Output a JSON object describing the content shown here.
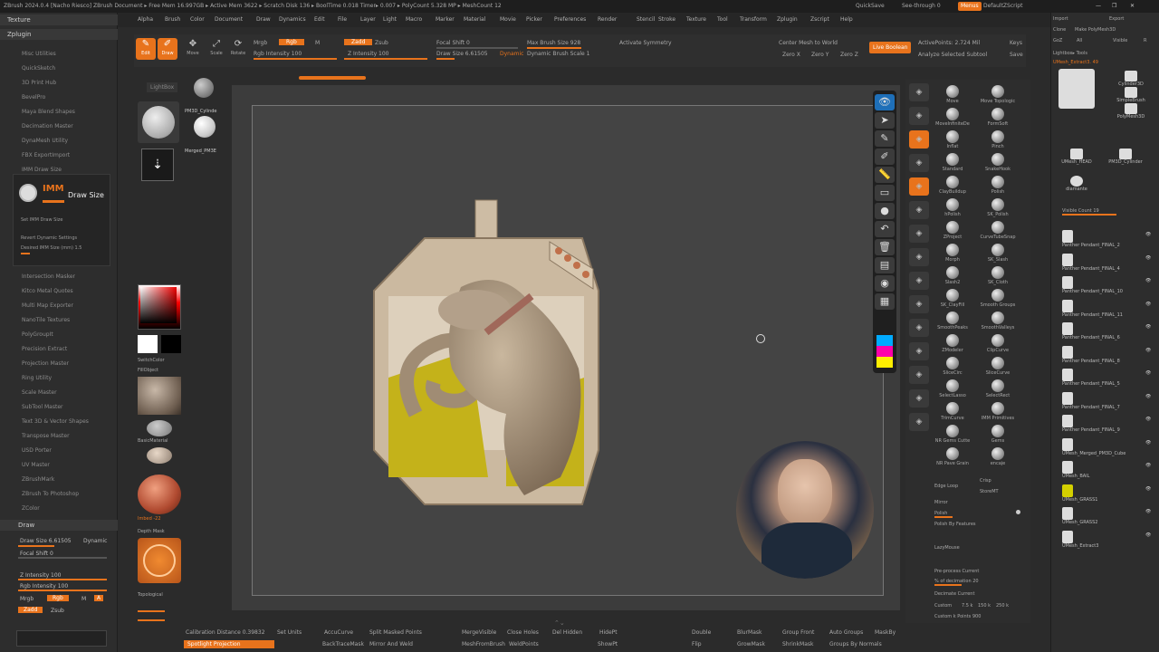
{
  "titlebar": {
    "text": "ZBrush 2024.0.4 [Nacho Riesco]  ZBrush Document   ▸ Free Mem 16.997GB ▸ Active Mem 3622 ▸ Scratch Disk 136 ▸ BoolTime 0.018 Timer▸ 0.007 ▸ PolyCount 5.328 MP ▸ MeshCount 12",
    "quicksave": "QuickSave",
    "seethrough": "See-through 0",
    "menus": "Menus",
    "defaultzscript": "DefaultZScript"
  },
  "menubar": [
    "Alpha",
    "Brush",
    "Color",
    "Document",
    "Draw",
    "Dynamics",
    "Edit",
    "File",
    "Layer",
    "Light",
    "Macro",
    "Marker",
    "Material",
    "Movie",
    "Picker",
    "Preferences",
    "Render",
    "Stencil",
    "Stroke",
    "Texture",
    "Tool",
    "Transform",
    "Zplugin",
    "Zscript",
    "Help"
  ],
  "left_panel": {
    "texture_header": "Texture",
    "zplugin_header": "Zplugin",
    "plugins": [
      "Misc Utilities",
      "QuickSketch",
      "3D Print Hub",
      "BevelPro",
      "Maya Blend Shapes",
      "Decimation Master",
      "DynaMesh Utility",
      "FBX ExportImport",
      "IMM Draw Size"
    ],
    "imm_label": "IMM",
    "draw_size_label": "Draw Size",
    "imm_sub": [
      "Set IMM Draw Size",
      "Revert Dynamic Settings",
      "Desired IMM Size (mm) 1.5"
    ],
    "plugins2": [
      "Intersection Masker",
      "Kitco Metal Quotes",
      "Multi Map Exporter",
      "NanoTile Textures",
      "PolyGroupIt",
      "Precision Extract",
      "Projection Master",
      "Ring Utility",
      "Scale Master",
      "SubTool Master",
      "Text 3D & Vector Shapes",
      "Transpose Master",
      "USD Porter",
      "UV Master",
      "ZBrushMark",
      "ZBrush To Photoshop",
      "ZColor"
    ],
    "draw_header": "Draw",
    "draw_size": "Draw Size 6.61505",
    "dynamic": "Dynamic",
    "focal_shift": "Focal Shift 0",
    "z_intensity": "Z Intensity 100",
    "rgb_intensity": "Rgb Intensity 100",
    "mrgb": "Mrgb",
    "rgb": "Rgb",
    "m": "M",
    "a": "A",
    "zadd": "Zadd",
    "zsub": "Zsub"
  },
  "topshelf": {
    "edit": "Edit",
    "draw": "Draw",
    "move": "Move",
    "scale": "Scale",
    "rotate": "Rotate",
    "mrgb": "Mrgb",
    "rgb": "Rgb",
    "m": "M",
    "rgb_intensity": "Rgb Intensity 100",
    "zadd": "Zadd",
    "zsub": "Zsub",
    "z_intensity": "Z Intensity 100",
    "focal_shift": "Focal Shift 0",
    "draw_size": "Draw Size 6.61505",
    "dynamic": "Dynamic",
    "max_brush_size": "Max Brush Size 928",
    "dynamic_brush_scale": "Dynamic Brush Scale 1",
    "activate_symmetry": "Activate Symmetry",
    "center_mesh": "Center Mesh to World",
    "zxyz": [
      "Zero X",
      "Zero Y",
      "Zero Z"
    ],
    "live_boolean": "Live Boolean",
    "active_points": "ActivePoints: 2.724 Mil",
    "analyze": "Analyze Selected Subtool",
    "keys": "Keys",
    "save": "Save"
  },
  "left_tools": {
    "lightbox": "LightBox",
    "pm3d": "PM3D_Cylinde",
    "merged": "Merged_PM3E",
    "switchcolor": "SwitchColor",
    "fillobject": "FillObject",
    "basicmaterial": "BasicMaterial",
    "depthmask": "Depth Mask",
    "topological": "Topological",
    "imbed": "Imbed -22"
  },
  "viewport_tools": [
    "eye-icon",
    "cursor-icon",
    "pen-icon",
    "brush-icon",
    "ruler-icon",
    "eraser-icon",
    "dot-icon",
    "undo-icon",
    "trash-icon",
    "print-icon",
    "camera-icon",
    "clipboard-icon"
  ],
  "brushes": [
    [
      "Move",
      "Move Topologic"
    ],
    [
      "MoveInfiniteDe",
      "FormSoft"
    ],
    [
      "Inflat",
      "Pinch"
    ],
    [
      "Standard",
      "SnakeHook"
    ],
    [
      "ClayBuildup",
      "Polish"
    ],
    [
      "hPolish",
      "SK_Polish"
    ],
    [
      "ZProject",
      "CurveTubeSnap"
    ],
    [
      "Morph",
      "SK_Slash"
    ],
    [
      "Slash2",
      "SK_Cloth"
    ],
    [
      "SK_ClayFill",
      "Smooth Groups"
    ],
    [
      "SmoothPeaks",
      "SmoothValleys"
    ],
    [
      "ZModeler",
      "ClipCurve"
    ],
    [
      "SliceCirc",
      "SliceCurve"
    ],
    [
      "SelectLasso",
      "SelectRect"
    ],
    [
      "TrimCurve",
      "IMM Primitives"
    ],
    [
      "NR Gems Cutte",
      "Gems"
    ],
    [
      "NR Pave Grain",
      "encaje"
    ]
  ],
  "right_tray_bottom": {
    "edge_loop": "Edge Loop",
    "crisp": "Crisp",
    "storemt": "StoreMT",
    "mirror": "Mirror",
    "polish": "Polish",
    "polish_by_features": "Polish By Features",
    "lazymouse": "LazyMouse",
    "preprocess": "Pre-process Current",
    "pct_decimation": "% of decimation 20",
    "decimate_current": "Decimate Current",
    "custom": "Custom",
    "custom_vals": [
      "7.5 k",
      "150 k",
      "250 k"
    ],
    "custom_k_points": "Custom k Points 900"
  },
  "subtool": {
    "import": "Import",
    "export": "Export",
    "clone": "Clone",
    "make_polymesh": "Make PolyMesh3D",
    "go": "GoZ",
    "all": "All",
    "visible": "Visible",
    "r": "R",
    "lightbox_tools": "Lightbox▸ Tools",
    "umesh_extract": "UMesh_Extract3. 49",
    "tool_thumbs": [
      "Cylinder3D",
      "SimpleBrush",
      "PolyMesh3D",
      "UMesh_HEAD",
      "PM3D_Cylinder",
      "diamante"
    ],
    "visible_count": "Visible Count 19",
    "items": [
      "Panther Pendant_FINAL_2",
      "Panther Pendant_FINAL_4",
      "Panther Pendant_FINAL_10",
      "Panther Pendant_FINAL_11",
      "Panther Pendant_FINAL_6",
      "Panther Pendant_FINAL_8",
      "Panther Pendant_FINAL_5",
      "Panther Pendant_FINAL_7",
      "Panther Pendant_FINAL_9",
      "UMesh_Merged_PM3D_Cube",
      "UMesh_BAIL",
      "UMesh_GRASS1",
      "UMesh_GRASS2",
      "UMesh_Extract3"
    ]
  },
  "bottombar": {
    "calib": "Calibration Distance 0.39832",
    "spotlight": "Spotlight Projection",
    "set_units": "Set Units",
    "accucurve": "AccuCurve",
    "backtrace": "BackTraceMask",
    "split_masked": "Split Masked Points",
    "mirror_weld": "Mirror And Weld",
    "mergevisible": "MergeVisible",
    "meshfrombrush": "MeshFromBrush",
    "close_holes": "Close Holes",
    "weldpoints": "WeldPoints",
    "del_hidden": "Del Hidden",
    "hidept": "HidePt",
    "showpt": "ShowPt",
    "double": "Double",
    "flip": "Flip",
    "blurmask": "BlurMask",
    "growmask": "GrowMask",
    "group_front": "Group Front",
    "shrinkmask": "ShrinkMask",
    "auto_groups": "Auto Groups",
    "groups_normals": "Groups By Normals",
    "maskby": "MaskBy"
  }
}
